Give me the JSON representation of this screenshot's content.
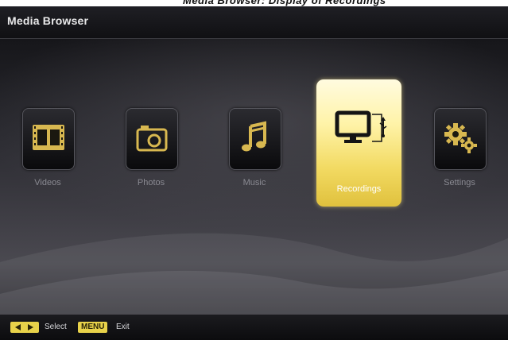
{
  "top_text": "Media Browser: Display of Recordings",
  "header": {
    "title": "Media Browser"
  },
  "menu": {
    "items": [
      {
        "id": "videos",
        "label": "Videos",
        "icon": "film-icon",
        "selected": false
      },
      {
        "id": "photos",
        "label": "Photos",
        "icon": "camera-icon",
        "selected": false
      },
      {
        "id": "music",
        "label": "Music",
        "icon": "music-note-icon",
        "selected": false
      },
      {
        "id": "recordings",
        "label": "Recordings",
        "icon": "monitor-usb-icon",
        "selected": true
      },
      {
        "id": "settings",
        "label": "Settings",
        "icon": "gears-icon",
        "selected": false
      }
    ]
  },
  "footer": {
    "select_label": "Select",
    "menu_key": "MENU",
    "exit_label": "Exit"
  },
  "colors": {
    "accent_gold": "#e8d24a",
    "icon_gold": "#d8b850",
    "selected_tile": "#fff3a8",
    "background_dark": "#18181c"
  }
}
